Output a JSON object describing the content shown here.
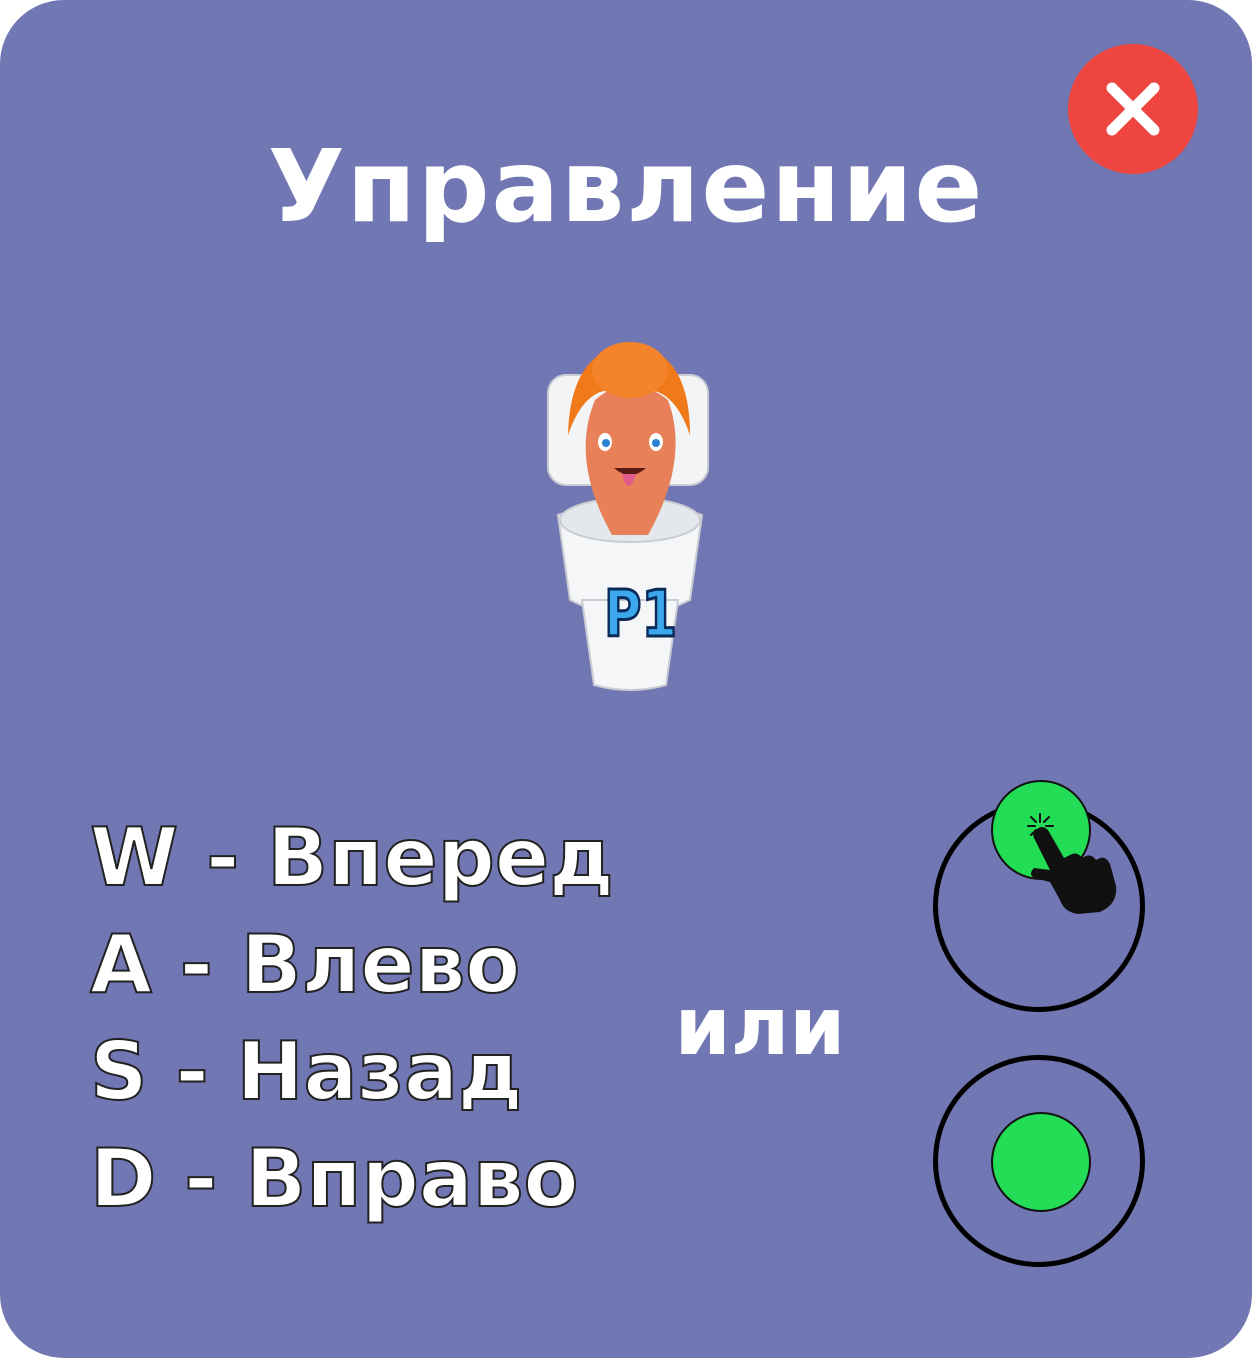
{
  "dialog": {
    "title": "Управление"
  },
  "character": {
    "label": "P1"
  },
  "controls": [
    {
      "text": "W - Вперед"
    },
    {
      "text": "A - Влево"
    },
    {
      "text": "S - Назад"
    },
    {
      "text": "D - Вправо"
    }
  ],
  "or_label": "или",
  "icons": {
    "close": "close-icon",
    "hand": "hand-pointer-icon",
    "joystick": "joystick-icon"
  },
  "colors": {
    "panel": "#7177b3",
    "close": "#ee4540",
    "knob": "#22dd55",
    "hair": "#f07a1a",
    "skin": "#e8805a"
  }
}
